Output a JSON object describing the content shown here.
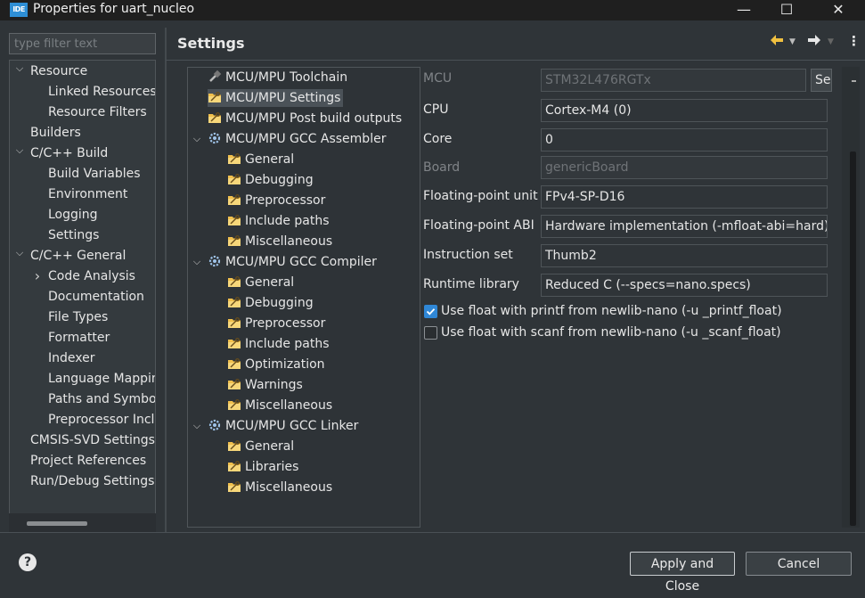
{
  "window": {
    "title": "Properties for uart_nucleo",
    "app_icon_text": "IDE",
    "minimize": "—",
    "maximize": "☐",
    "close": "✕"
  },
  "filter": {
    "placeholder": "type filter text"
  },
  "nav": [
    {
      "label": "Resource",
      "expanded": true
    },
    {
      "label": "Linked Resources"
    },
    {
      "label": "Resource Filters"
    },
    {
      "label": "Builders"
    },
    {
      "label": "C/C++ Build",
      "expanded": true
    },
    {
      "label": "Build Variables"
    },
    {
      "label": "Environment"
    },
    {
      "label": "Logging"
    },
    {
      "label": "Settings"
    },
    {
      "label": "C/C++ General",
      "expanded": true
    },
    {
      "label": "Code Analysis",
      "expanded": false
    },
    {
      "label": "Documentation"
    },
    {
      "label": "File Types"
    },
    {
      "label": "Formatter"
    },
    {
      "label": "Indexer"
    },
    {
      "label": "Language Mappin"
    },
    {
      "label": "Paths and Symbols"
    },
    {
      "label": "Preprocessor Inclu"
    },
    {
      "label": "CMSIS-SVD Settings"
    },
    {
      "label": "Project References"
    },
    {
      "label": "Run/Debug Settings"
    }
  ],
  "header": {
    "title": "Settings",
    "back_icon": "arrow-left-icon",
    "forward_icon": "arrow-right-icon"
  },
  "tool_tree": [
    {
      "label": "MCU/MPU Toolchain",
      "icon": "toolchain-icon"
    },
    {
      "label": "MCU/MPU Settings",
      "icon": "folder-settings-icon",
      "selected": true
    },
    {
      "label": "MCU/MPU Post build outputs",
      "icon": "folder-settings-icon"
    },
    {
      "label": "MCU/MPU GCC Assembler",
      "icon": "gear-icon",
      "expanded": true
    },
    {
      "label": "General",
      "icon": "folder-settings-icon"
    },
    {
      "label": "Debugging",
      "icon": "folder-settings-icon"
    },
    {
      "label": "Preprocessor",
      "icon": "folder-settings-icon"
    },
    {
      "label": "Include paths",
      "icon": "folder-settings-icon"
    },
    {
      "label": "Miscellaneous",
      "icon": "folder-settings-icon"
    },
    {
      "label": "MCU/MPU GCC Compiler",
      "icon": "gear-icon",
      "expanded": true
    },
    {
      "label": "General",
      "icon": "folder-settings-icon"
    },
    {
      "label": "Debugging",
      "icon": "folder-settings-icon"
    },
    {
      "label": "Preprocessor",
      "icon": "folder-settings-icon"
    },
    {
      "label": "Include paths",
      "icon": "folder-settings-icon"
    },
    {
      "label": "Optimization",
      "icon": "folder-settings-icon"
    },
    {
      "label": "Warnings",
      "icon": "folder-settings-icon"
    },
    {
      "label": "Miscellaneous",
      "icon": "folder-settings-icon"
    },
    {
      "label": "MCU/MPU GCC Linker",
      "icon": "gear-icon",
      "expanded": true
    },
    {
      "label": "General",
      "icon": "folder-settings-icon"
    },
    {
      "label": "Libraries",
      "icon": "folder-settings-icon"
    },
    {
      "label": "Miscellaneous",
      "icon": "folder-settings-icon"
    }
  ],
  "form": {
    "mcu": {
      "label": "MCU",
      "value": "STM32L476RGTx",
      "button": "Se"
    },
    "cpu": {
      "label": "CPU",
      "value": "Cortex-M4 (0)"
    },
    "core": {
      "label": "Core",
      "value": "0"
    },
    "board": {
      "label": "Board",
      "value": "genericBoard"
    },
    "fpu": {
      "label": "Floating-point unit",
      "value": "FPv4-SP-D16"
    },
    "fpabi": {
      "label": "Floating-point ABI",
      "value": "Hardware implementation (-mfloat-abi=hard)"
    },
    "iset": {
      "label": "Instruction set",
      "value": "Thumb2"
    },
    "runtime": {
      "label": "Runtime library",
      "value": "Reduced C (--specs=nano.specs)"
    },
    "printf_float": {
      "label": "Use float with printf from newlib-nano (-u _printf_float)",
      "checked": true
    },
    "scanf_float": {
      "label": "Use float with scanf from newlib-nano (-u _scanf_float)",
      "checked": false
    }
  },
  "footer": {
    "apply_close": "Apply and Close",
    "cancel": "Cancel",
    "help": "?"
  },
  "colors": {
    "accent": "#2f87d6",
    "background": "#2f3438",
    "titlebar": "#1f1f1f"
  }
}
